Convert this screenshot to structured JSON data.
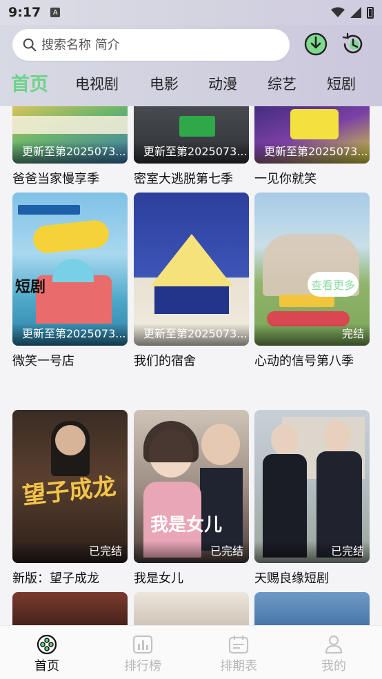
{
  "status_bar": {
    "time": "9:17",
    "notification_letter": "A"
  },
  "header": {
    "search_placeholder": "搜索名称 简介",
    "download_icon": "download-icon",
    "history_icon": "history-icon"
  },
  "tabs": [
    {
      "label": "首页",
      "active": true
    },
    {
      "label": "电视剧"
    },
    {
      "label": "电影"
    },
    {
      "label": "动漫"
    },
    {
      "label": "综艺"
    },
    {
      "label": "短剧"
    }
  ],
  "rows": [
    {
      "cards": [
        {
          "title": "爸爸当家慢享季",
          "badge": "更新至第2025073..."
        },
        {
          "title": "密室大逃脱第七季",
          "badge": "更新至第2025073..."
        },
        {
          "title": "一见你就笑",
          "badge": "更新至第2025073..."
        }
      ]
    },
    {
      "cards": [
        {
          "title": "微笑一号店",
          "badge": "更新至第2025073..."
        },
        {
          "title": "我们的宿舍",
          "badge": "更新至第2025073..."
        },
        {
          "title": "心动的信号第八季",
          "badge": "完结"
        }
      ]
    }
  ],
  "section": {
    "title": "短剧",
    "more_label": "查看更多"
  },
  "short_dramas": [
    {
      "title": "新版：望子成龙",
      "badge": "已完结",
      "poster_text": "望子成龙"
    },
    {
      "title": "我是女儿",
      "badge": "已完结",
      "poster_text": "我是女儿"
    },
    {
      "title": "天赐良缘短剧",
      "badge": "已完结",
      "poster_text": ""
    }
  ],
  "bottom_nav": [
    {
      "label": "首页",
      "icon": "home-film-icon",
      "active": true
    },
    {
      "label": "排行榜",
      "icon": "chart-icon"
    },
    {
      "label": "排期表",
      "icon": "calendar-icon"
    },
    {
      "label": "我的",
      "icon": "profile-icon"
    }
  ],
  "colors": {
    "accent": "#6ed38a",
    "accent_light": "#8fdca4"
  }
}
